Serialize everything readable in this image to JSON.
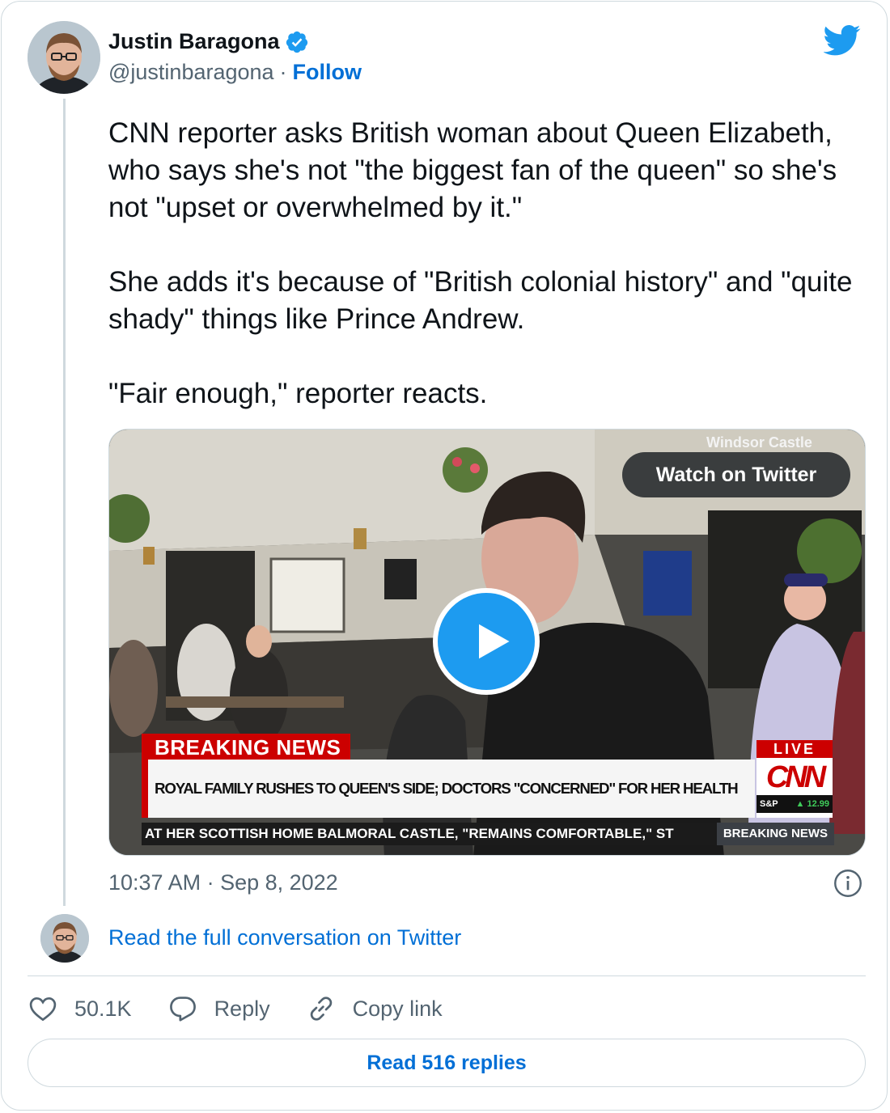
{
  "author": {
    "name": "Justin Baragona",
    "handle": "@justinbaragona",
    "separator": "·",
    "follow_label": "Follow",
    "verified": true
  },
  "tweet": {
    "paragraphs": [
      "CNN reporter asks British woman about Queen Elizabeth, who says she's not \"the biggest fan of the queen\" so she's not \"upset or overwhelmed by it.\"",
      "She adds it's because of \"British colonial history\" and \"quite shady\" things like Prince Andrew.",
      "\"Fair enough,\" reporter reacts."
    ],
    "timestamp": "10:37 AM · Sep 8, 2022"
  },
  "media": {
    "location_tag": "Windsor Castle",
    "watch_label": "Watch on Twitter",
    "breaking_label": "BREAKING NEWS",
    "headline": "ROYAL FAMILY RUSHES TO QUEEN'S SIDE; DOCTORS \"CONCERNED\" FOR HER HEALTH",
    "live_label": "LIVE",
    "network_logo": "CNN",
    "ticker_symbol": "S&P",
    "ticker_value": "▲ 12.99",
    "crawl_text": "AT HER SCOTTISH HOME BALMORAL CASTLE, \"REMAINS COMFORTABLE,\" ST",
    "crawl_tag": "BREAKING NEWS"
  },
  "conversation": {
    "read_full_label": "Read the full conversation on Twitter"
  },
  "actions": {
    "likes": "50.1K",
    "reply_label": "Reply",
    "copy_label": "Copy link"
  },
  "replies_button": "Read 516 replies",
  "colors": {
    "accent": "#1d9bf0",
    "link": "#006fd6",
    "muted": "#536471",
    "border": "#cfd9de",
    "breaking_red": "#cc0000"
  },
  "icons": [
    "twitter-bird-icon",
    "verified-badge-icon",
    "play-icon",
    "info-icon",
    "heart-icon",
    "reply-icon",
    "link-icon"
  ]
}
